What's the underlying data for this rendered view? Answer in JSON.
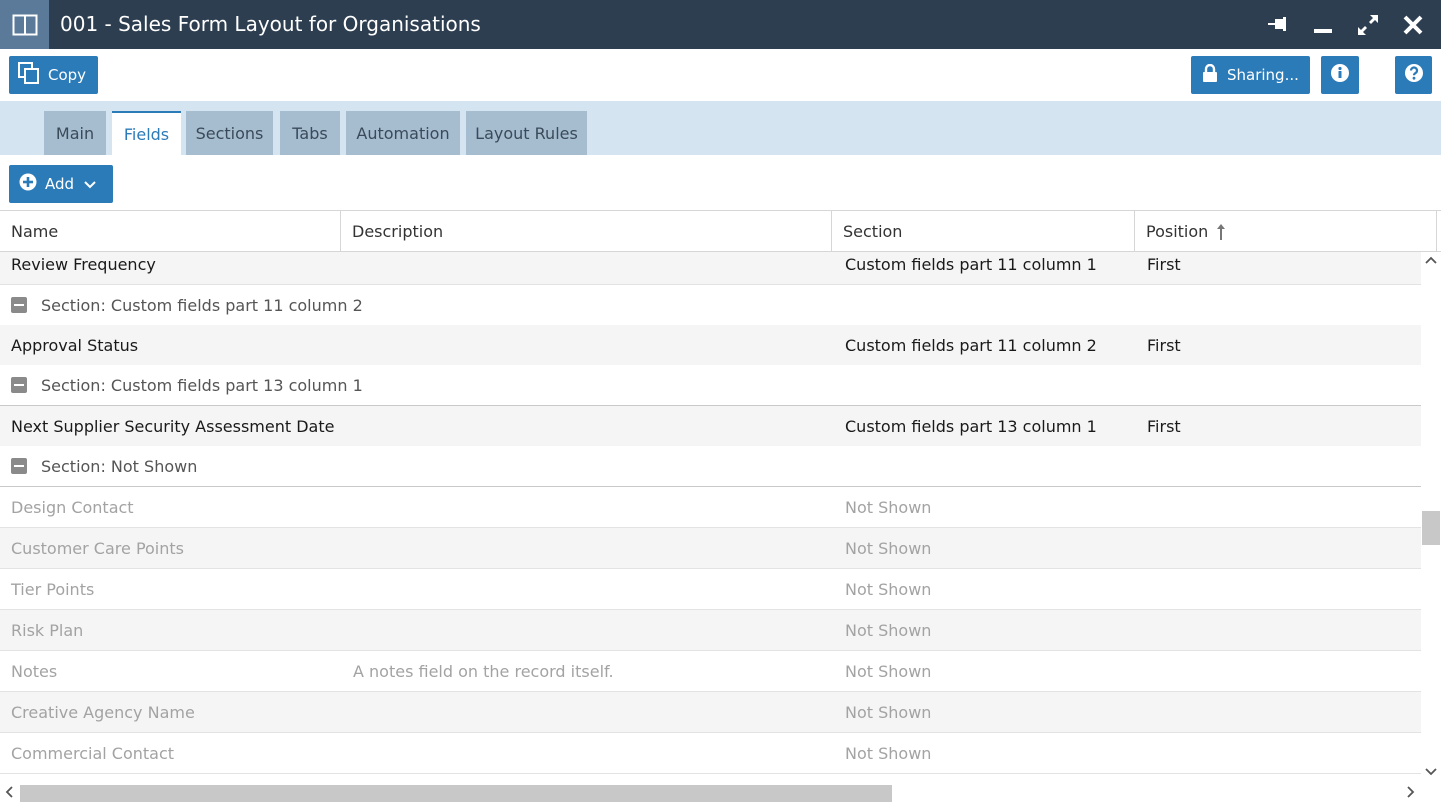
{
  "window": {
    "title": "001 - Sales Form Layout for Organisations"
  },
  "toolbar": {
    "copy_label": "Copy",
    "sharing_label": "Sharing..."
  },
  "tabs": [
    {
      "label": "Main",
      "active": false
    },
    {
      "label": "Fields",
      "active": true
    },
    {
      "label": "Sections",
      "active": false
    },
    {
      "label": "Tabs",
      "active": false
    },
    {
      "label": "Automation",
      "active": false
    },
    {
      "label": "Layout Rules",
      "active": false
    }
  ],
  "add_label": "Add",
  "columns": {
    "name": "Name",
    "description": "Description",
    "section": "Section",
    "position": "Position"
  },
  "rows": [
    {
      "type": "data",
      "name": "Review Frequency",
      "description": "",
      "section": "Custom fields part 11 column 1",
      "position": "First"
    },
    {
      "type": "group",
      "label": "Section: Custom fields part 11 column 2"
    },
    {
      "type": "data",
      "name": "Approval Status",
      "description": "",
      "section": "Custom fields part 11 column 2",
      "position": "First"
    },
    {
      "type": "group",
      "label": "Section: Custom fields part 13 column 1"
    },
    {
      "type": "data",
      "name": "Next Supplier Security Assessment Date",
      "description": "",
      "section": "Custom fields part 13 column 1",
      "position": "First"
    },
    {
      "type": "group",
      "label": "Section: Not Shown"
    },
    {
      "type": "dim",
      "name": "Design Contact",
      "description": "",
      "section": "Not Shown",
      "position": ""
    },
    {
      "type": "dim",
      "name": "Customer Care Points",
      "description": "",
      "section": "Not Shown",
      "position": ""
    },
    {
      "type": "dim",
      "name": "Tier Points",
      "description": "",
      "section": "Not Shown",
      "position": ""
    },
    {
      "type": "dim",
      "name": "Risk Plan",
      "description": "",
      "section": "Not Shown",
      "position": ""
    },
    {
      "type": "dim",
      "name": "Notes",
      "description": "A notes field on the record itself.",
      "section": "Not Shown",
      "position": ""
    },
    {
      "type": "dim",
      "name": "Creative Agency Name",
      "description": "",
      "section": "Not Shown",
      "position": ""
    },
    {
      "type": "dim",
      "name": "Commercial Contact",
      "description": "",
      "section": "Not Shown",
      "position": ""
    }
  ]
}
